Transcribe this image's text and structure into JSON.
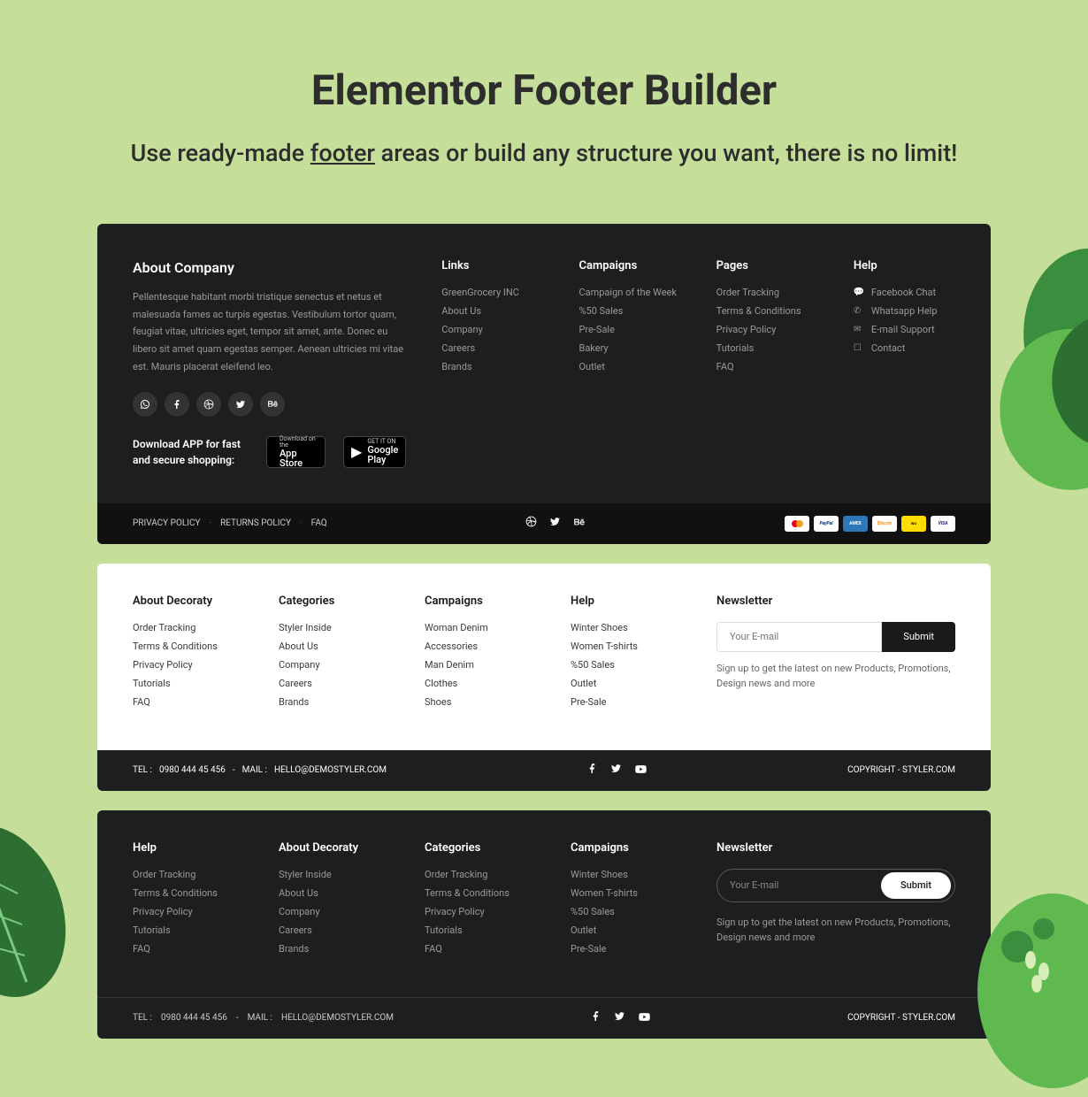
{
  "header": {
    "title": "Elementor Footer Builder",
    "subtitle_before": "Use ready-made ",
    "subtitle_underline": "footer",
    "subtitle_after": " areas or build any structure you want, there is no limit!"
  },
  "footer1": {
    "about": {
      "heading": "About Company",
      "text": "Pellentesque habitant morbi tristique senectus et netus et malesuada fames ac turpis egestas. Vestibulum tortor quam, feugiat vitae, ultricies eget, tempor sit amet, ante. Donec eu libero sit amet quam egestas semper. Aenean ultricies mi vitae est. Mauris placerat eleifend leo."
    },
    "download_label": "Download APP for fast and secure shopping:",
    "appstore": {
      "small": "Download on the",
      "large": "App Store"
    },
    "playstore": {
      "small": "GET IT ON",
      "large": "Google Play"
    },
    "links": {
      "heading": "Links",
      "items": [
        "GreenGrocery INC",
        "About Us",
        "Company",
        "Careers",
        "Brands"
      ]
    },
    "campaigns": {
      "heading": "Campaigns",
      "items": [
        "Campaign of the Week",
        "%50 Sales",
        "Pre-Sale",
        "Bakery",
        "Outlet"
      ]
    },
    "pages": {
      "heading": "Pages",
      "items": [
        "Order Tracking",
        "Terms & Conditions",
        "Privacy Policy",
        "Tutorials",
        "FAQ"
      ]
    },
    "help": {
      "heading": "Help",
      "items": [
        "Facebook Chat",
        "Whatsapp Help",
        "E-mail Support",
        "Contact"
      ]
    },
    "legal": [
      "PRIVACY POLICY",
      "RETURNS POLICY",
      "FAQ"
    ],
    "payments": [
      "MasterCard",
      "PayPal",
      "Amex",
      "Bitcoin",
      "WesternUnion",
      "Visa"
    ]
  },
  "footer2": {
    "about": {
      "heading": "About Decoraty",
      "items": [
        "Order Tracking",
        "Terms & Conditions",
        "Privacy Policy",
        "Tutorials",
        "FAQ"
      ]
    },
    "categories": {
      "heading": "Categories",
      "items": [
        "Styler Inside",
        "About Us",
        "Company",
        "Careers",
        "Brands"
      ]
    },
    "campaigns": {
      "heading": "Campaigns",
      "items": [
        "Woman Denim",
        "Accessories",
        "Man Denim",
        "Clothes",
        "Shoes"
      ]
    },
    "help": {
      "heading": "Help",
      "items": [
        "Winter Shoes",
        "Women T-shirts",
        "%50 Sales",
        "Outlet",
        "Pre-Sale"
      ]
    },
    "newsletter": {
      "heading": "Newsletter",
      "placeholder": "Your E-mail",
      "submit": "Submit",
      "text": "Sign up to get the latest on new Products, Promotions, Design news and more"
    },
    "contact": {
      "tel_label": "TEL :",
      "tel": "0980 444 45 456",
      "sep": "-",
      "mail_label": "MAIL :",
      "mail": "HELLO@DEMOSTYLER.COM"
    },
    "copyright": "COPYRIGHT - STYLER.COM"
  },
  "footer3": {
    "help": {
      "heading": "Help",
      "items": [
        "Order Tracking",
        "Terms & Conditions",
        "Privacy Policy",
        "Tutorials",
        "FAQ"
      ]
    },
    "about": {
      "heading": "About Decoraty",
      "items": [
        "Styler Inside",
        "About Us",
        "Company",
        "Careers",
        "Brands"
      ]
    },
    "categories": {
      "heading": "Categories",
      "items": [
        "Order Tracking",
        "Terms & Conditions",
        "Privacy Policy",
        "Tutorials",
        "FAQ"
      ]
    },
    "campaigns": {
      "heading": "Campaigns",
      "items": [
        "Winter Shoes",
        "Women T-shirts",
        "%50 Sales",
        "Outlet",
        "Pre-Sale"
      ]
    },
    "newsletter": {
      "heading": "Newsletter",
      "placeholder": "Your E-mail",
      "submit": "Submit",
      "text": "Sign up to get the latest on new Products, Promotions, Design news and more"
    },
    "contact": {
      "tel_label": "TEL :",
      "tel": "0980 444 45 456",
      "sep": "-",
      "mail_label": "MAIL :",
      "mail": "HELLO@DEMOSTYLER.COM"
    },
    "copyright": "COPYRIGHT - STYLER.COM"
  }
}
